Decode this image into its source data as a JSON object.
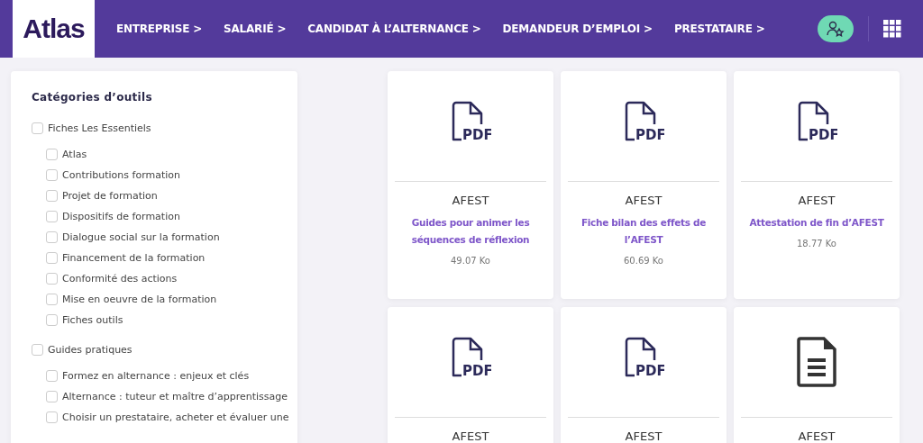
{
  "header": {
    "logo": "Atlas",
    "nav": [
      {
        "label": "ENTREPRISE >"
      },
      {
        "label": "SALARIÉ >"
      },
      {
        "label": "CANDIDAT À L’ALTERNANCE >"
      },
      {
        "label": "DEMANDEUR D’EMPLOI >"
      },
      {
        "label": "PRESTATAIRE >"
      }
    ]
  },
  "sidebar": {
    "title": "Catégories d’outils",
    "groups": [
      {
        "label": "Fiches Les Essentiels",
        "checked": false,
        "children": [
          {
            "label": "Atlas",
            "checked": false
          },
          {
            "label": "Contributions formation",
            "checked": false
          },
          {
            "label": "Projet de formation",
            "checked": false
          },
          {
            "label": "Dispositifs de formation",
            "checked": false
          },
          {
            "label": "Dialogue social sur la formation",
            "checked": false
          },
          {
            "label": "Financement de la formation",
            "checked": false
          },
          {
            "label": "Conformité des actions",
            "checked": false
          },
          {
            "label": "Mise en oeuvre de la formation",
            "checked": false
          },
          {
            "label": "Fiches outils",
            "checked": false
          }
        ]
      },
      {
        "label": "Guides pratiques",
        "checked": false,
        "children": [
          {
            "label": "Formez en alternance : enjeux et clés",
            "checked": false
          },
          {
            "label": "Alternance : tuteur et maître d’apprentissage",
            "checked": false
          },
          {
            "label": "Choisir un prestataire, acheter et évaluer une",
            "checked": false
          }
        ]
      }
    ]
  },
  "cards": [
    {
      "kind": "pdf",
      "icon_label": "PDF",
      "category": "AFEST",
      "title": "Guides pour animer les séquences de réflexion",
      "size": "49.07 Ko"
    },
    {
      "kind": "pdf",
      "icon_label": "PDF",
      "category": "AFEST",
      "title": "Fiche bilan des effets de l’AFEST",
      "size": "60.69 Ko"
    },
    {
      "kind": "pdf",
      "icon_label": "PDF",
      "category": "AFEST",
      "title": "Attestation de fin d’AFEST",
      "size": "18.77 Ko"
    },
    {
      "kind": "pdf",
      "icon_label": "PDF",
      "category": "AFEST"
    },
    {
      "kind": "pdf",
      "icon_label": "PDF",
      "category": "AFEST"
    },
    {
      "kind": "doc",
      "category": "AFEST"
    }
  ]
}
